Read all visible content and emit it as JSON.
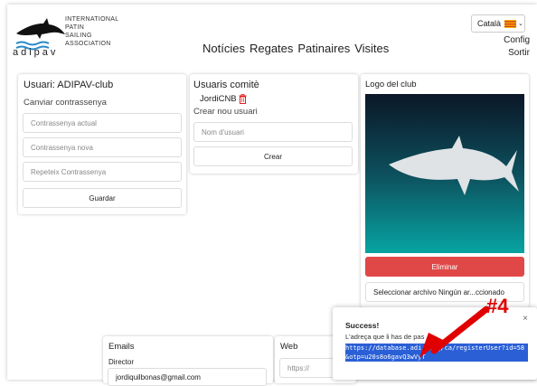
{
  "header": {
    "org_lines": [
      "INTERNATIONAL",
      "PATIN",
      "SAILING",
      "ASSOCIATION"
    ],
    "brand": "adipav",
    "language": "Català",
    "nav": [
      "Notícies",
      "Regates",
      "Patinaires",
      "Visites"
    ],
    "right_nav": [
      "Config",
      "Sortir"
    ]
  },
  "user_card": {
    "title": "Usuari: ADIPAV-club",
    "subtitle": "Canviar contrassenya",
    "current_password_placeholder": "Contrassenya actual",
    "new_password_placeholder": "Contrassenya nova",
    "repeat_password_placeholder": "Repeteix Contrassenya",
    "save_label": "Guardar"
  },
  "committee_card": {
    "title": "Usuaris comitè",
    "users": [
      "JordiCNB"
    ],
    "create_title": "Crear nou usuari",
    "username_placeholder": "Nom d'usuari",
    "create_label": "Crear"
  },
  "logo_card": {
    "title": "Logo del club",
    "delete_label": "Eliminar",
    "file_label": "Seleccionar archivo Ningún ar...ccionado"
  },
  "emails_card": {
    "title": "Emails",
    "director_label": "Director",
    "director_value": "jordiquilbonas@gmail.com"
  },
  "web_card": {
    "title": "Web",
    "placeholder": "https://"
  },
  "toast": {
    "title": "Success!",
    "message": "L'adreça que li has de pas",
    "link": "https://database.adi    .org/ca/registerUser?id=58&otp=u20s8o6gavQ3wVyT",
    "annotation": "#4",
    "colors": {
      "highlight": "#2a5fd6",
      "arrow": "#e00000"
    }
  },
  "colors": {
    "danger": "#e04848",
    "teal_top": "#0a1a2a",
    "teal_bottom": "#08a3a0"
  }
}
